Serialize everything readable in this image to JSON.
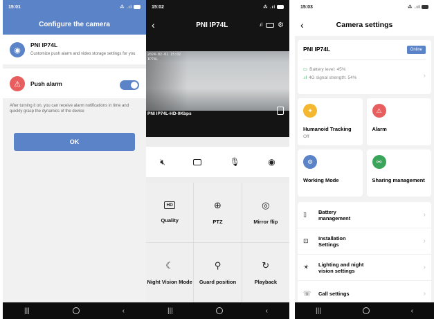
{
  "screen1": {
    "status": {
      "time": "15:01",
      "signal": "⁂ .ıl"
    },
    "title": "Configure the camera",
    "device": {
      "name": "PNI IP74L",
      "description": "Customize push alarm and video storage settings for you"
    },
    "push_alarm": {
      "label": "Push alarm",
      "enabled": true
    },
    "hint": "After turning it on, you can receive alarm notifications in time and quickly grasp the dynamics of the device",
    "ok_label": "OK"
  },
  "screen2": {
    "status": {
      "time": "15:02",
      "signal": "⁂ .ıl"
    },
    "title": "PNI IP74L",
    "back_glyph": "‹",
    "header_tools": ".ıl",
    "video_label": "PNI IP74L-HD-0Kbps",
    "video_osd_line1": "2024-02-01 15:02",
    "video_osd_line2": "IP74L",
    "controls": [
      {
        "name": "mute",
        "glyph": "🔇︎"
      },
      {
        "name": "record",
        "glyph": "▭"
      },
      {
        "name": "talk",
        "glyph": "🎙︎"
      },
      {
        "name": "snapshot",
        "glyph": "◉"
      }
    ],
    "features": [
      {
        "label": "Quality",
        "glyph": "HD"
      },
      {
        "label": "PTZ",
        "glyph": "⊕"
      },
      {
        "label": "Mirror flip",
        "glyph": "◎"
      },
      {
        "label": "Night Vision Mode",
        "glyph": "☾"
      },
      {
        "label": "Guard position",
        "glyph": "⚲"
      },
      {
        "label": "Playback",
        "glyph": "↻"
      }
    ]
  },
  "screen3": {
    "status": {
      "time": "15:03",
      "signal": "⁂ .ıl"
    },
    "title": "Camera settings",
    "back_glyph": "‹",
    "device": {
      "name": "PNI IP74L",
      "status_badge": "Online",
      "battery_label": "Battery level: 45%",
      "signal_label": "4G signal strength: 54%"
    },
    "tiles": [
      {
        "label": "Humanoid Tracking",
        "sub": "Off",
        "color": "#f4b730",
        "glyph": "✦"
      },
      {
        "label": "Alarm",
        "sub": "",
        "color": "#e85d5d",
        "glyph": "⚠"
      },
      {
        "label": "Working Mode",
        "sub": "",
        "color": "#5b84c8",
        "glyph": "⚙"
      },
      {
        "label": "Sharing management",
        "sub": "",
        "color": "#3aa55a",
        "glyph": "⚯"
      }
    ],
    "list": [
      {
        "label_line1": "Battery",
        "label_line2": "management",
        "glyph": "▯"
      },
      {
        "label_line1": "Installation",
        "label_line2": "Settings",
        "glyph": "⊡"
      },
      {
        "label_line1": "Lighting and night",
        "label_line2": "vision settings",
        "glyph": "☀"
      },
      {
        "label_line1": "Call settings",
        "label_line2": "",
        "glyph": "☏"
      }
    ]
  },
  "colors": {
    "accent": "#5b84c8",
    "alarm": "#e85d5d",
    "success": "#3aa55a",
    "warning": "#f4b730"
  }
}
